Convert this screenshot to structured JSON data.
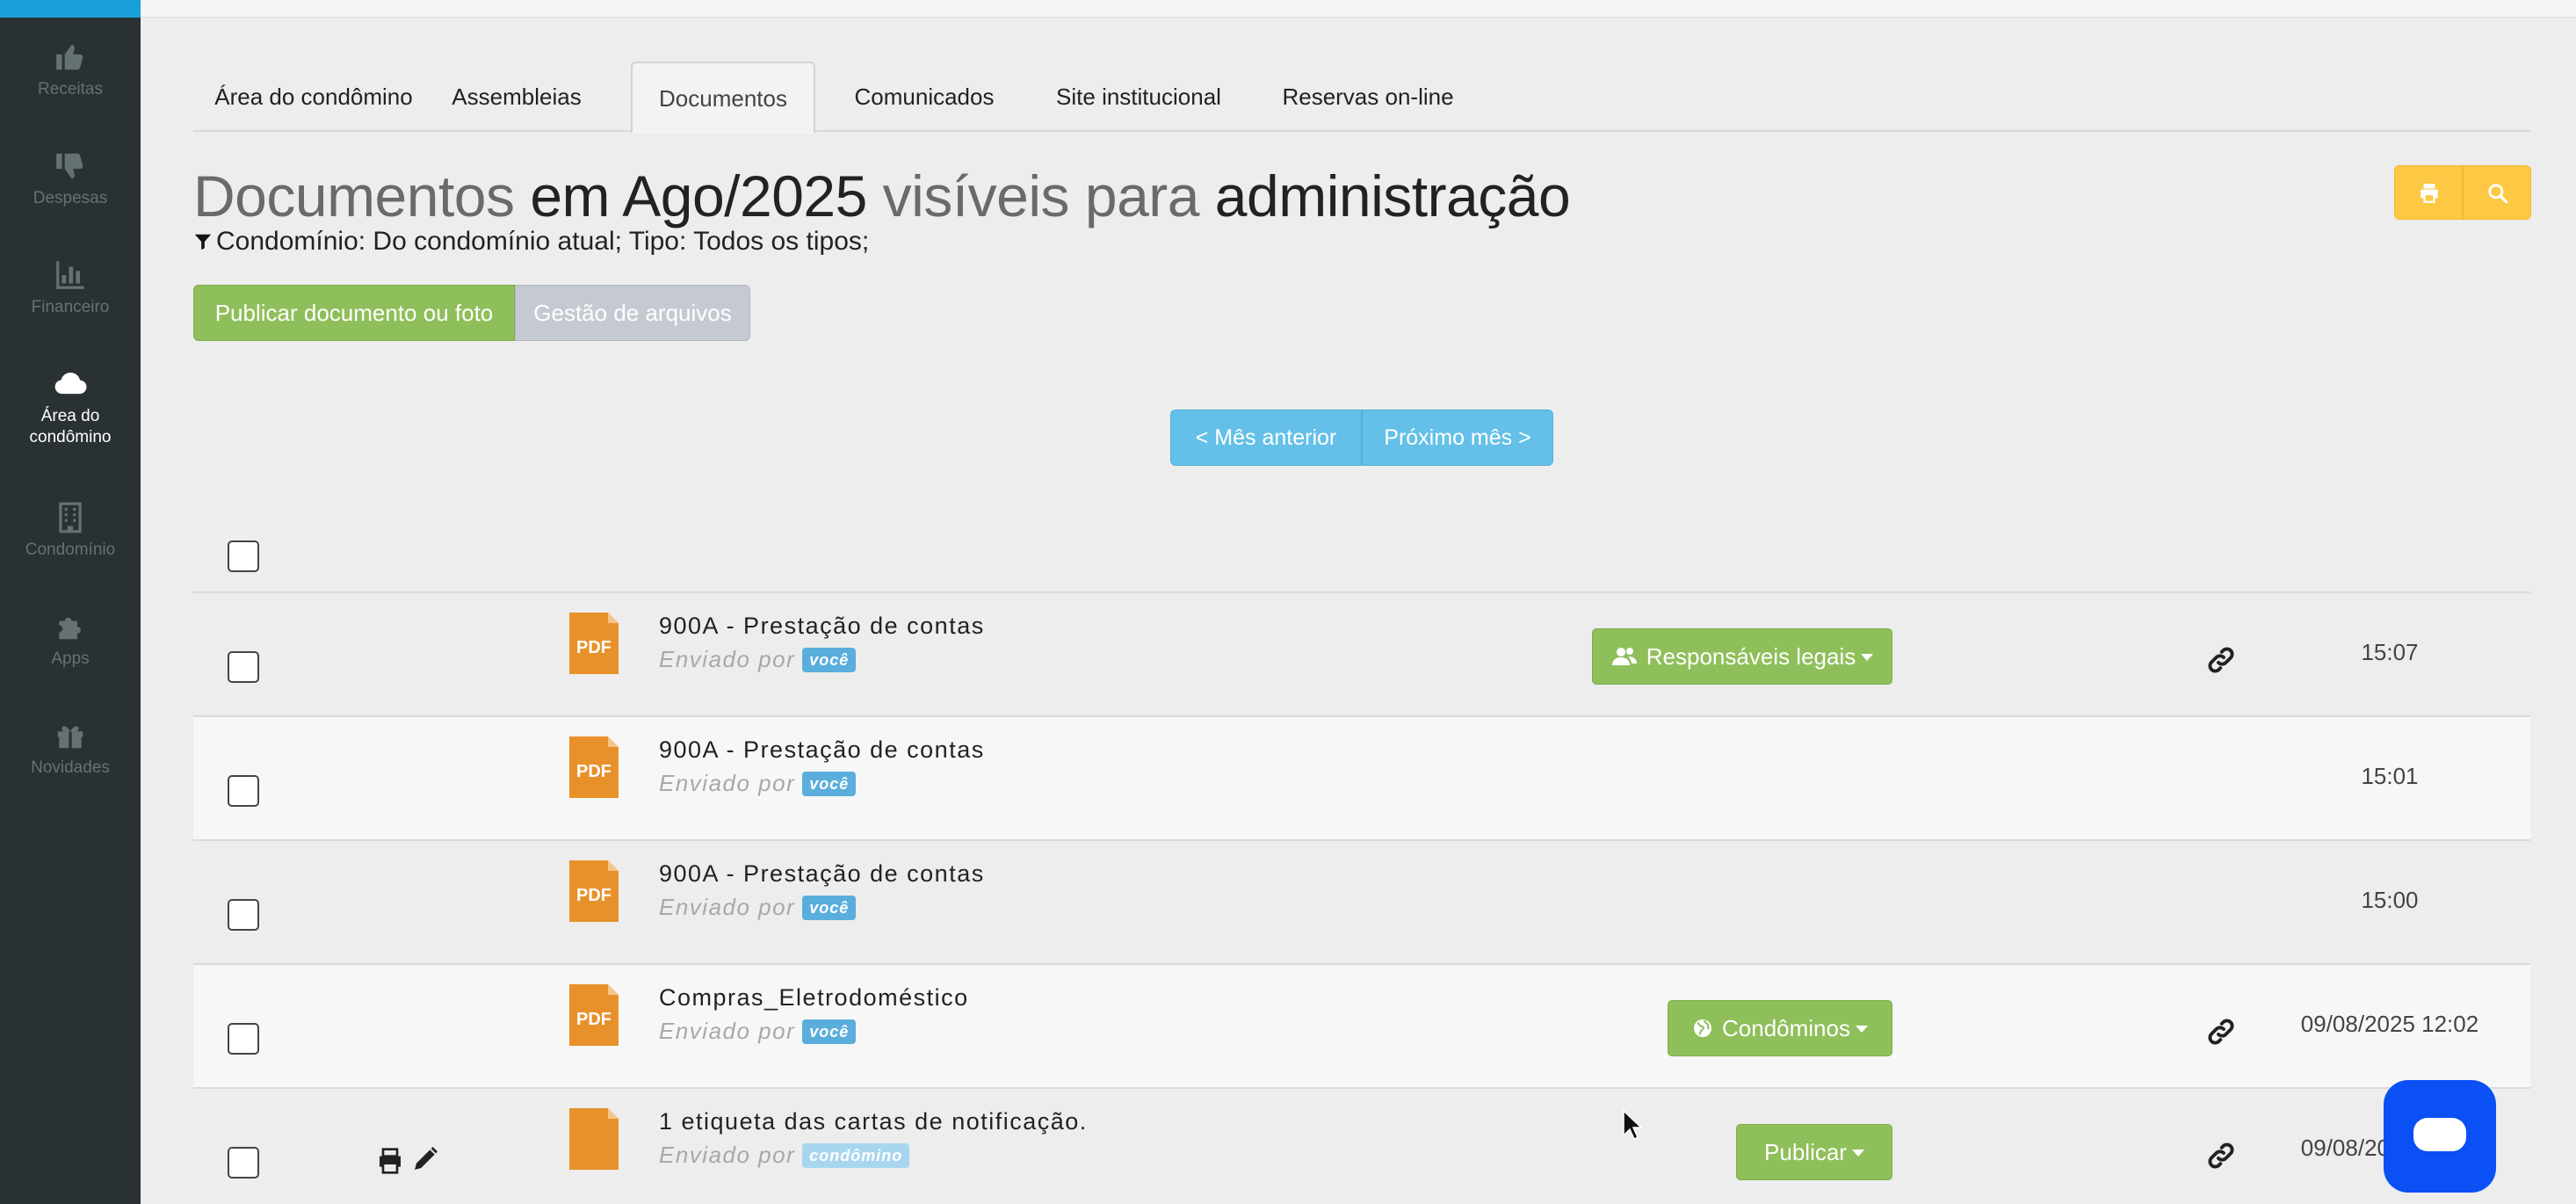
{
  "sidebar": {
    "items": [
      {
        "label": "Receitas",
        "icon": "thumbs-up-icon"
      },
      {
        "label": "Despesas",
        "icon": "thumbs-down-icon"
      },
      {
        "label": "Financeiro",
        "icon": "bar-chart-icon"
      },
      {
        "label": "Área do condômino",
        "icon": "cloud-icon",
        "active": true
      },
      {
        "label": "Condomínio",
        "icon": "building-icon"
      },
      {
        "label": "Apps",
        "icon": "puzzle-icon"
      },
      {
        "label": "Novidades",
        "icon": "gift-icon"
      }
    ]
  },
  "tabs": [
    {
      "label": "Área do condômino"
    },
    {
      "label": "Assembleias"
    },
    {
      "label": "Documentos",
      "active": true
    },
    {
      "label": "Comunicados"
    },
    {
      "label": "Site institucional"
    },
    {
      "label": "Reservas on-line"
    }
  ],
  "header": {
    "title_part1": "Documentos",
    "title_part2": " em Ago/2025",
    "title_part3": " visíveis para",
    "title_part4": " administração",
    "filter_text": "Condomínio: Do condomínio atual; Tipo: Todos os tipos;"
  },
  "actions": {
    "publish_label": "Publicar documento ou foto",
    "files_label": "Gestão de arquivos",
    "prev_label": "< Mês anterior",
    "next_label": "Próximo mês >"
  },
  "documents": [
    {
      "name": "900A - Prestação de contas",
      "sent_prefix": "Enviado por",
      "sender": "você",
      "visibility": "Responsáveis legais",
      "time": "15:07",
      "has_link": true
    },
    {
      "name": "900A - Prestação de contas",
      "sent_prefix": "Enviado por",
      "sender": "você",
      "visibility": "",
      "time": "15:01",
      "has_link": false
    },
    {
      "name": "900A - Prestação de contas",
      "sent_prefix": "Enviado por",
      "sender": "você",
      "visibility": "",
      "time": "15:00",
      "has_link": false
    },
    {
      "name": "Compras_Eletrodoméstico",
      "sent_prefix": "Enviado por",
      "sender": "você",
      "visibility": "Condôminos",
      "time": "09/08/2025 12:02",
      "has_link": true
    },
    {
      "name": "1 etiqueta das cartas de notificação.",
      "sent_prefix": "Enviado por",
      "sender": "condômino",
      "visibility": "Publicar",
      "time": "09/08/2025 12:00",
      "has_link": true
    }
  ],
  "icons": {
    "pdf_label": "PDF"
  },
  "colors": {
    "sidebar_bg": "#293133",
    "accent_blue": "#1a9fd9",
    "green": "#8fbf5a",
    "yellow": "#fdc844",
    "light_blue": "#64c0e8",
    "pdf_orange": "#e8912a",
    "chat_blue": "#0a50f5"
  }
}
